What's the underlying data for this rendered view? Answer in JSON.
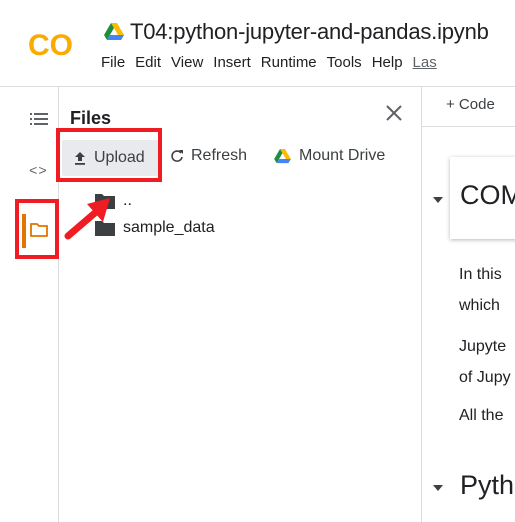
{
  "header": {
    "logo_text": "CO",
    "file_title": "T04:python-jupyter-and-pandas.ipynb",
    "menu": [
      "File",
      "Edit",
      "View",
      "Insert",
      "Runtime",
      "Tools",
      "Help"
    ],
    "last_edit_text": "Las"
  },
  "rail": {
    "code_glyph": "<>"
  },
  "files_panel": {
    "title": "Files",
    "actions": {
      "upload_label": "Upload",
      "refresh_label": "Refresh",
      "mount_label": "Mount Drive"
    },
    "tree": [
      {
        "label": ".."
      },
      {
        "label": "sample_data"
      }
    ]
  },
  "notebook": {
    "add_code_label": "+ Code",
    "heading_1": "COM",
    "para_lines": [
      "In this",
      "which",
      "Jupyte",
      "of Jupy",
      "All the"
    ],
    "heading_2": "Pyth"
  },
  "colors": {
    "highlight": "#ef1c24",
    "active_rail": "#e37400",
    "logo_orange": "#f9ab00"
  }
}
